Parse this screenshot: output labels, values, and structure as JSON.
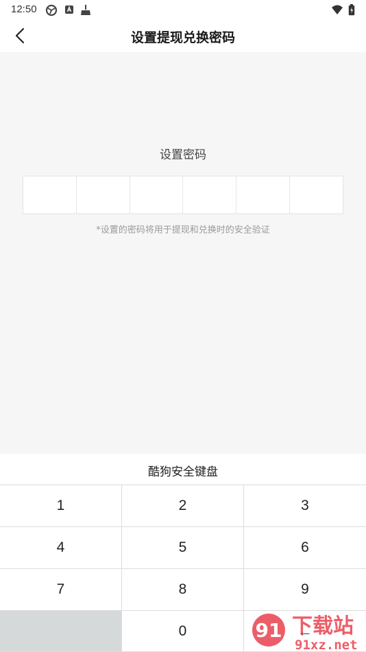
{
  "status_bar": {
    "time": "12:50",
    "left_icons": [
      "sync-icon",
      "a-badge-icon",
      "broom-icon"
    ],
    "right_icons": [
      "wifi-icon",
      "battery-icon"
    ]
  },
  "header": {
    "title": "设置提现兑换密码",
    "back_icon": "chevron-left-icon"
  },
  "main": {
    "label": "设置密码",
    "box_count": 6,
    "hint": "*设置的密码将用于提现和兑换时的安全验证"
  },
  "keyboard": {
    "title": "酷狗安全键盘",
    "keys": [
      "1",
      "2",
      "3",
      "4",
      "5",
      "6",
      "7",
      "8",
      "9",
      "",
      "0",
      "←"
    ]
  },
  "watermark": {
    "brand": "下载站",
    "url": "91xz.net"
  },
  "colors": {
    "page_bg": "#f6f6f6",
    "blank_key": "#d5d9d9",
    "watermark_red": "#e8434f"
  }
}
